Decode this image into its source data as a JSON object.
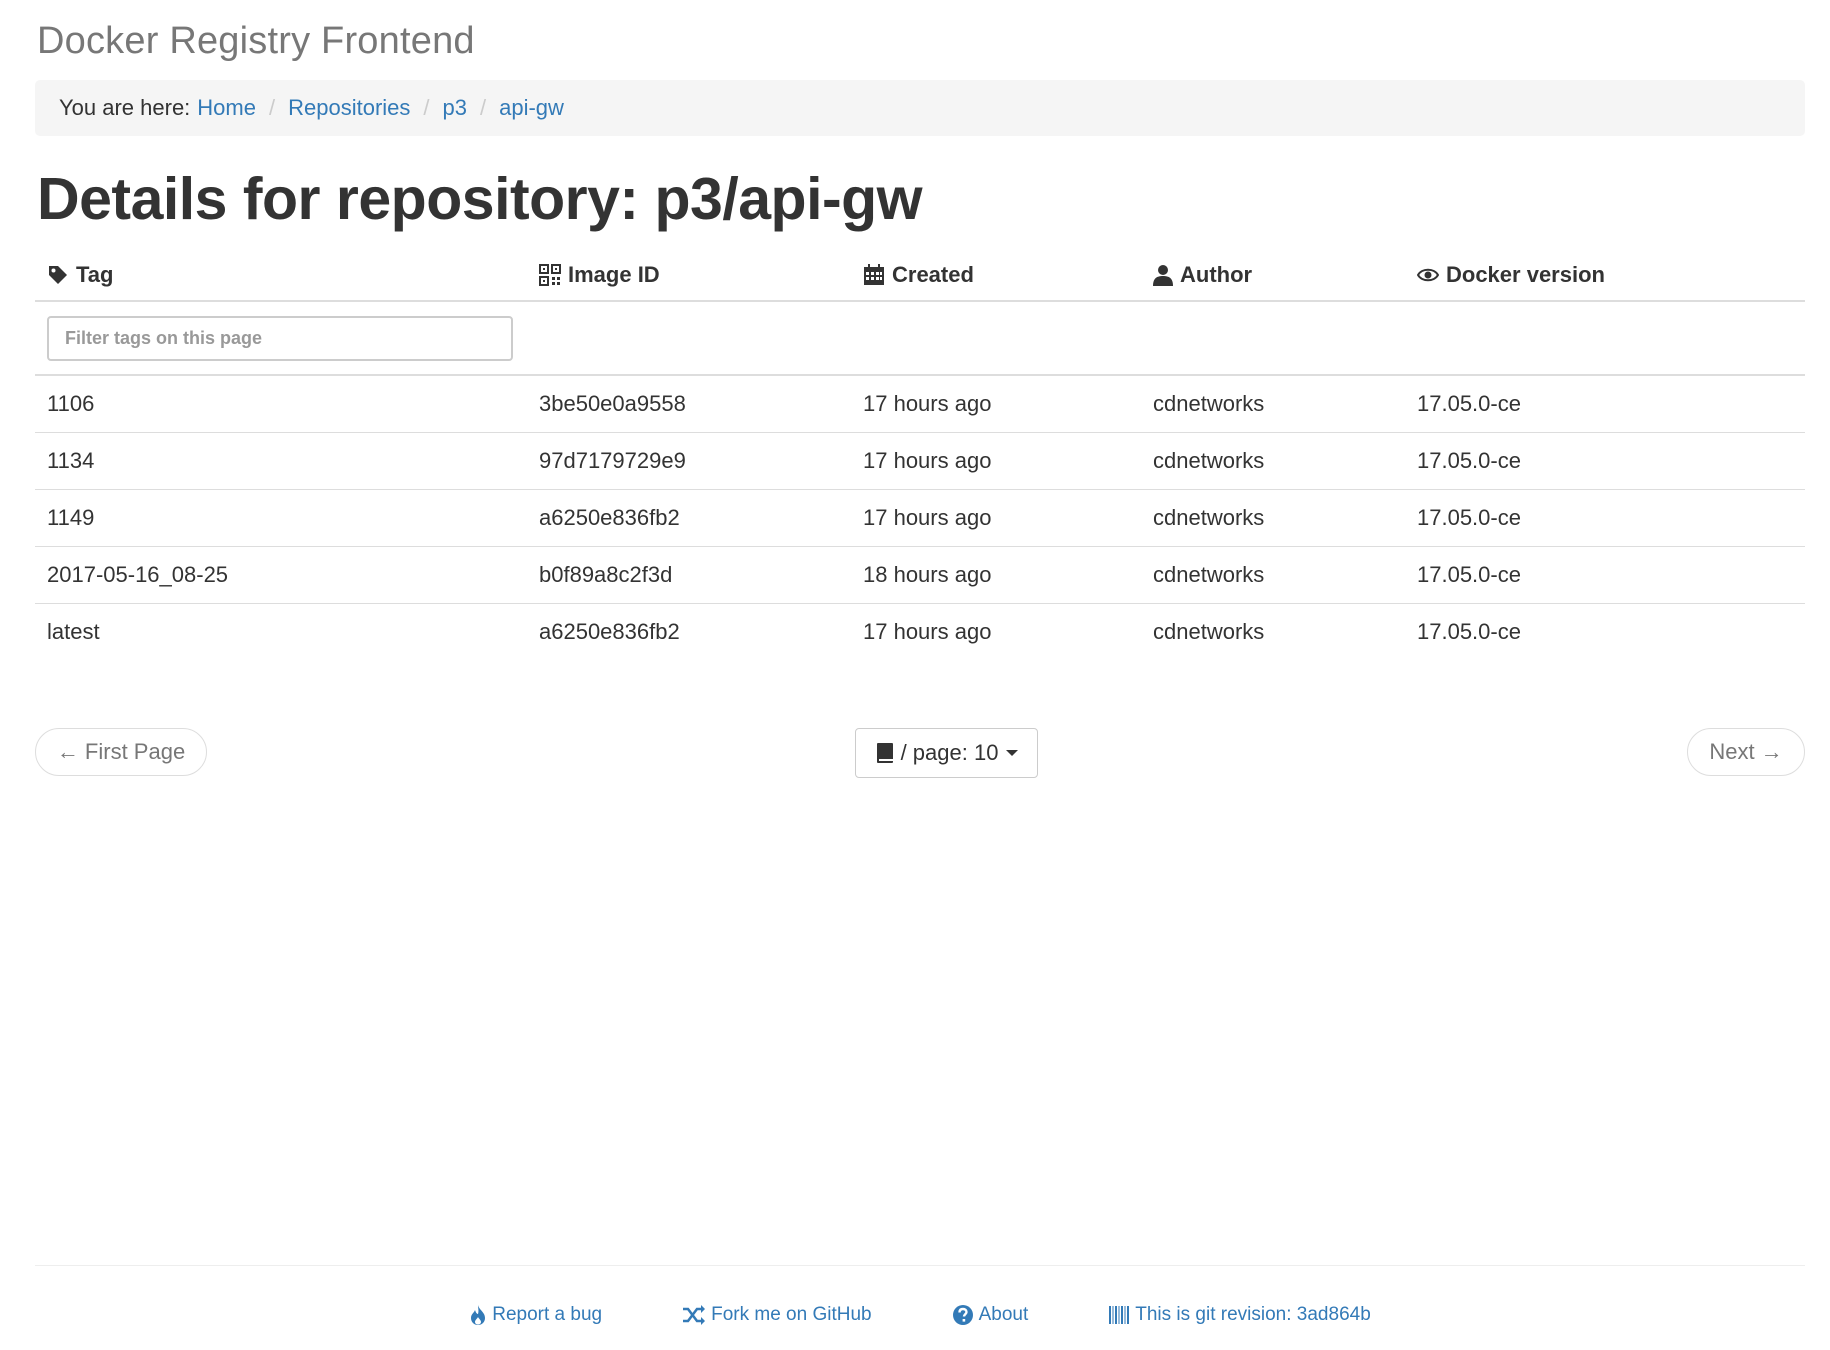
{
  "app": {
    "title": "Docker Registry Frontend"
  },
  "breadcrumb": {
    "prefix": "You are here:",
    "items": [
      {
        "label": "Home"
      },
      {
        "label": "Repositories"
      },
      {
        "label": "p3"
      },
      {
        "label": "api-gw"
      }
    ]
  },
  "page": {
    "title": "Details for repository: p3/api-gw"
  },
  "table": {
    "headers": {
      "tag": "Tag",
      "image_id": "Image ID",
      "created": "Created",
      "author": "Author",
      "docker_version": "Docker version"
    },
    "header_icons": [
      "tag-icon",
      "qrcode-icon",
      "calendar-icon",
      "user-icon",
      "eye-icon"
    ],
    "filter_placeholder": "Filter tags on this page",
    "rows": [
      {
        "tag": "1106",
        "image_id": "3be50e0a9558",
        "created": "17 hours ago",
        "author": "cdnetworks",
        "docker_version": "17.05.0-ce"
      },
      {
        "tag": "1134",
        "image_id": "97d7179729e9",
        "created": "17 hours ago",
        "author": "cdnetworks",
        "docker_version": "17.05.0-ce"
      },
      {
        "tag": "1149",
        "image_id": "a6250e836fb2",
        "created": "17 hours ago",
        "author": "cdnetworks",
        "docker_version": "17.05.0-ce"
      },
      {
        "tag": "2017-05-16_08-25",
        "image_id": "b0f89a8c2f3d",
        "created": "18 hours ago",
        "author": "cdnetworks",
        "docker_version": "17.05.0-ce"
      },
      {
        "tag": "latest",
        "image_id": "a6250e836fb2",
        "created": "17 hours ago",
        "author": "cdnetworks",
        "docker_version": "17.05.0-ce"
      }
    ]
  },
  "pager": {
    "first_label": "← First Page",
    "next_label": "Next →",
    "per_page_label": "/ page: 10"
  },
  "footer": {
    "report_bug": "Report a bug",
    "fork_github": "Fork me on GitHub",
    "about": "About",
    "git_revision": "This is git revision: 3ad864b"
  },
  "colors": {
    "link": "#337ab7",
    "muted": "#777777",
    "breadcrumb_bg": "#f5f5f5",
    "border": "#dddddd"
  }
}
